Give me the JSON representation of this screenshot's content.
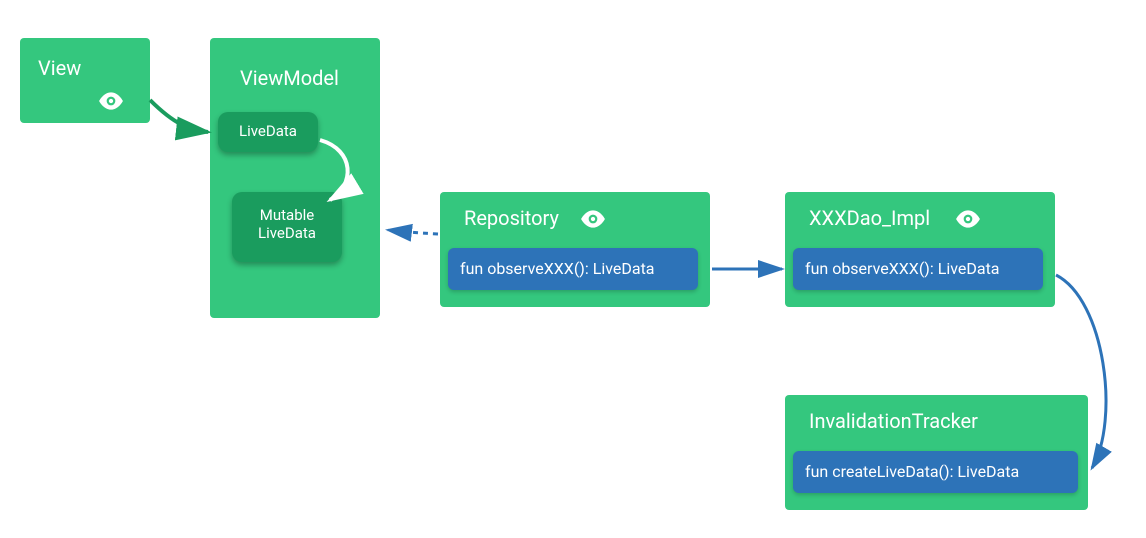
{
  "view": {
    "title": "View"
  },
  "viewmodel": {
    "title": "ViewModel",
    "livedata_label": "LiveData",
    "mutable_livedata_label": "Mutable\nLiveData"
  },
  "repository": {
    "title": "Repository",
    "fn": "fun observeXXX(): LiveData"
  },
  "dao": {
    "title": "XXXDao_Impl",
    "fn": "fun observeXXX(): LiveData"
  },
  "tracker": {
    "title": "InvalidationTracker",
    "fn": "fun createLiveData(): LiveData"
  },
  "colors": {
    "green": "#34c77e",
    "dark_green": "#1a9c5e",
    "blue": "#2d73b8"
  }
}
